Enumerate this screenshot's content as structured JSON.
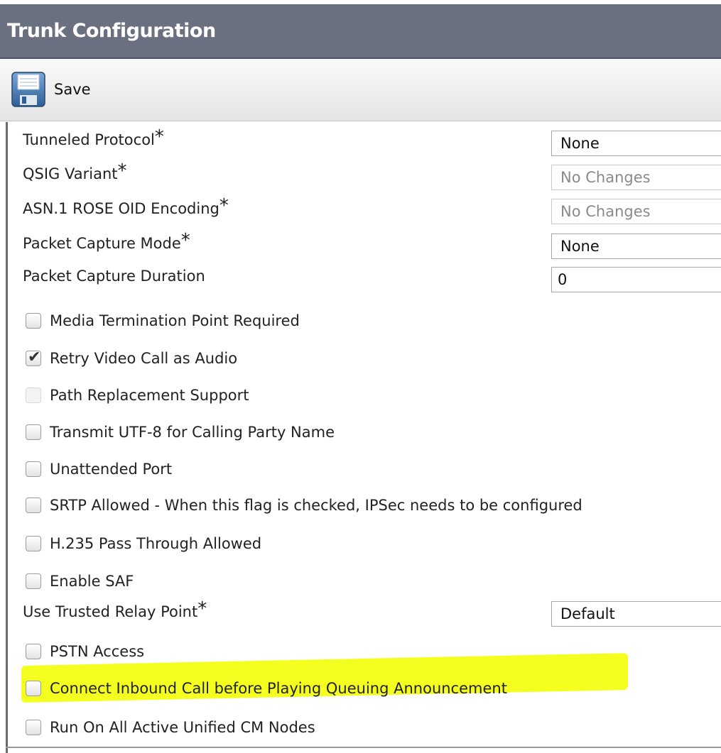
{
  "header": {
    "title": "Trunk Configuration"
  },
  "toolbar": {
    "save_label": "Save",
    "save_icon": "floppy-disk-icon"
  },
  "fields": {
    "tunneled_protocol": {
      "label": "Tunneled Protocol",
      "required": "*",
      "value": "None"
    },
    "qsig_variant": {
      "label": "QSIG Variant",
      "required": "*",
      "value": "No Changes",
      "disabled": true
    },
    "asn1_rose_oid": {
      "label": "ASN.1 ROSE OID Encoding",
      "required": "*",
      "value": "No Changes",
      "disabled": true
    },
    "packet_capture_mode": {
      "label": "Packet Capture Mode",
      "required": "*",
      "value": "None"
    },
    "packet_capture_duration": {
      "label": "Packet Capture Duration",
      "value": "0"
    },
    "use_trusted_relay_point": {
      "label": "Use Trusted Relay Point",
      "required": "*",
      "value": "Default"
    }
  },
  "checkboxes": {
    "media_termination_point": {
      "label": "Media Termination Point Required",
      "checked": false
    },
    "retry_video_call": {
      "label": "Retry Video Call as Audio",
      "checked": true
    },
    "path_replacement": {
      "label": "Path Replacement Support",
      "checked": false,
      "disabled": true
    },
    "transmit_utf8": {
      "label": "Transmit UTF-8 for Calling Party Name",
      "checked": false
    },
    "unattended_port": {
      "label": "Unattended Port",
      "checked": false
    },
    "srtp_allowed": {
      "label": "SRTP Allowed - When this flag is checked, IPSec needs to be configured",
      "checked": false
    },
    "h235_pass_through": {
      "label": "H.235 Pass Through Allowed",
      "checked": false
    },
    "enable_saf": {
      "label": "Enable SAF",
      "checked": false
    },
    "pstn_access": {
      "label": "PSTN Access",
      "checked": false
    },
    "connect_inbound_call": {
      "label": "Connect Inbound Call before Playing Queuing Announcement",
      "checked": false,
      "highlighted": true
    },
    "run_on_all_nodes": {
      "label": "Run On All Active Unified CM Nodes",
      "checked": false
    }
  },
  "colors": {
    "title_bar": "#6b7080",
    "highlight": "#f4ff1f"
  }
}
